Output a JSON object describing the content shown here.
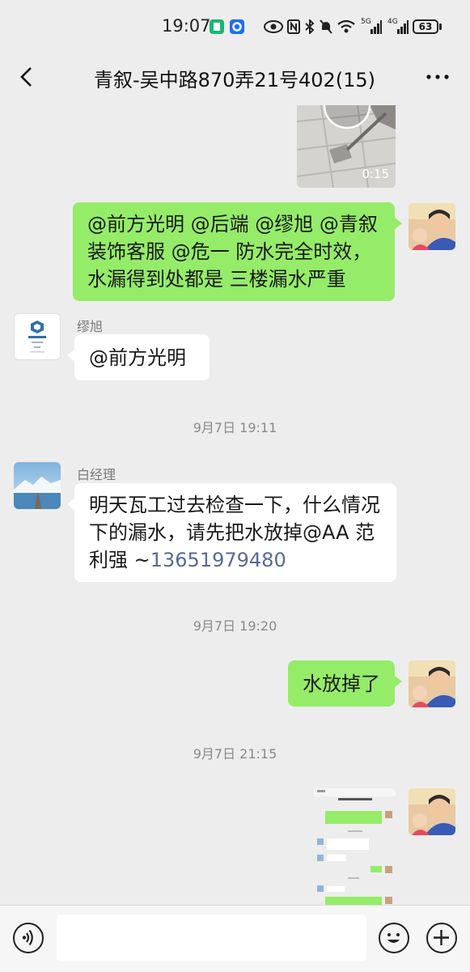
{
  "status_bar": {
    "time": "19:07",
    "network_1": "5G",
    "network_2": "4G",
    "battery": "63",
    "icons": [
      "app-green-icon",
      "app-blue-icon",
      "eye-icon",
      "nfc-icon",
      "bluetooth-icon",
      "mute-bell-icon",
      "wifi-icon",
      "signal-5g-icon",
      "signal-4g-icon",
      "battery-icon"
    ]
  },
  "header": {
    "title": "青叙-吴中路870弄21号402(15)"
  },
  "messages": {
    "video": {
      "duration": "0:15"
    },
    "msg1": {
      "text": "@前方光明 @后端 @缪旭 @青叙装饰客服 @危一  防水完全时效，水漏得到处都是 三楼漏水严重"
    },
    "msg2": {
      "sender": "缪旭",
      "text": "@前方光明"
    },
    "ts1": "9月7日 19:11",
    "msg3": {
      "sender": "白经理",
      "text": "明天瓦工过去检查一下，什么情况下的漏水，请先把水放掉@AA 范利强 ~",
      "phone": "13651979480"
    },
    "ts2": "9月7日 19:20",
    "msg4": {
      "text": "水放掉了"
    },
    "ts3": "9月7日 21:15"
  },
  "colors": {
    "green_bubble": "#95ec69",
    "background": "#ededed",
    "link": "#576b95"
  }
}
